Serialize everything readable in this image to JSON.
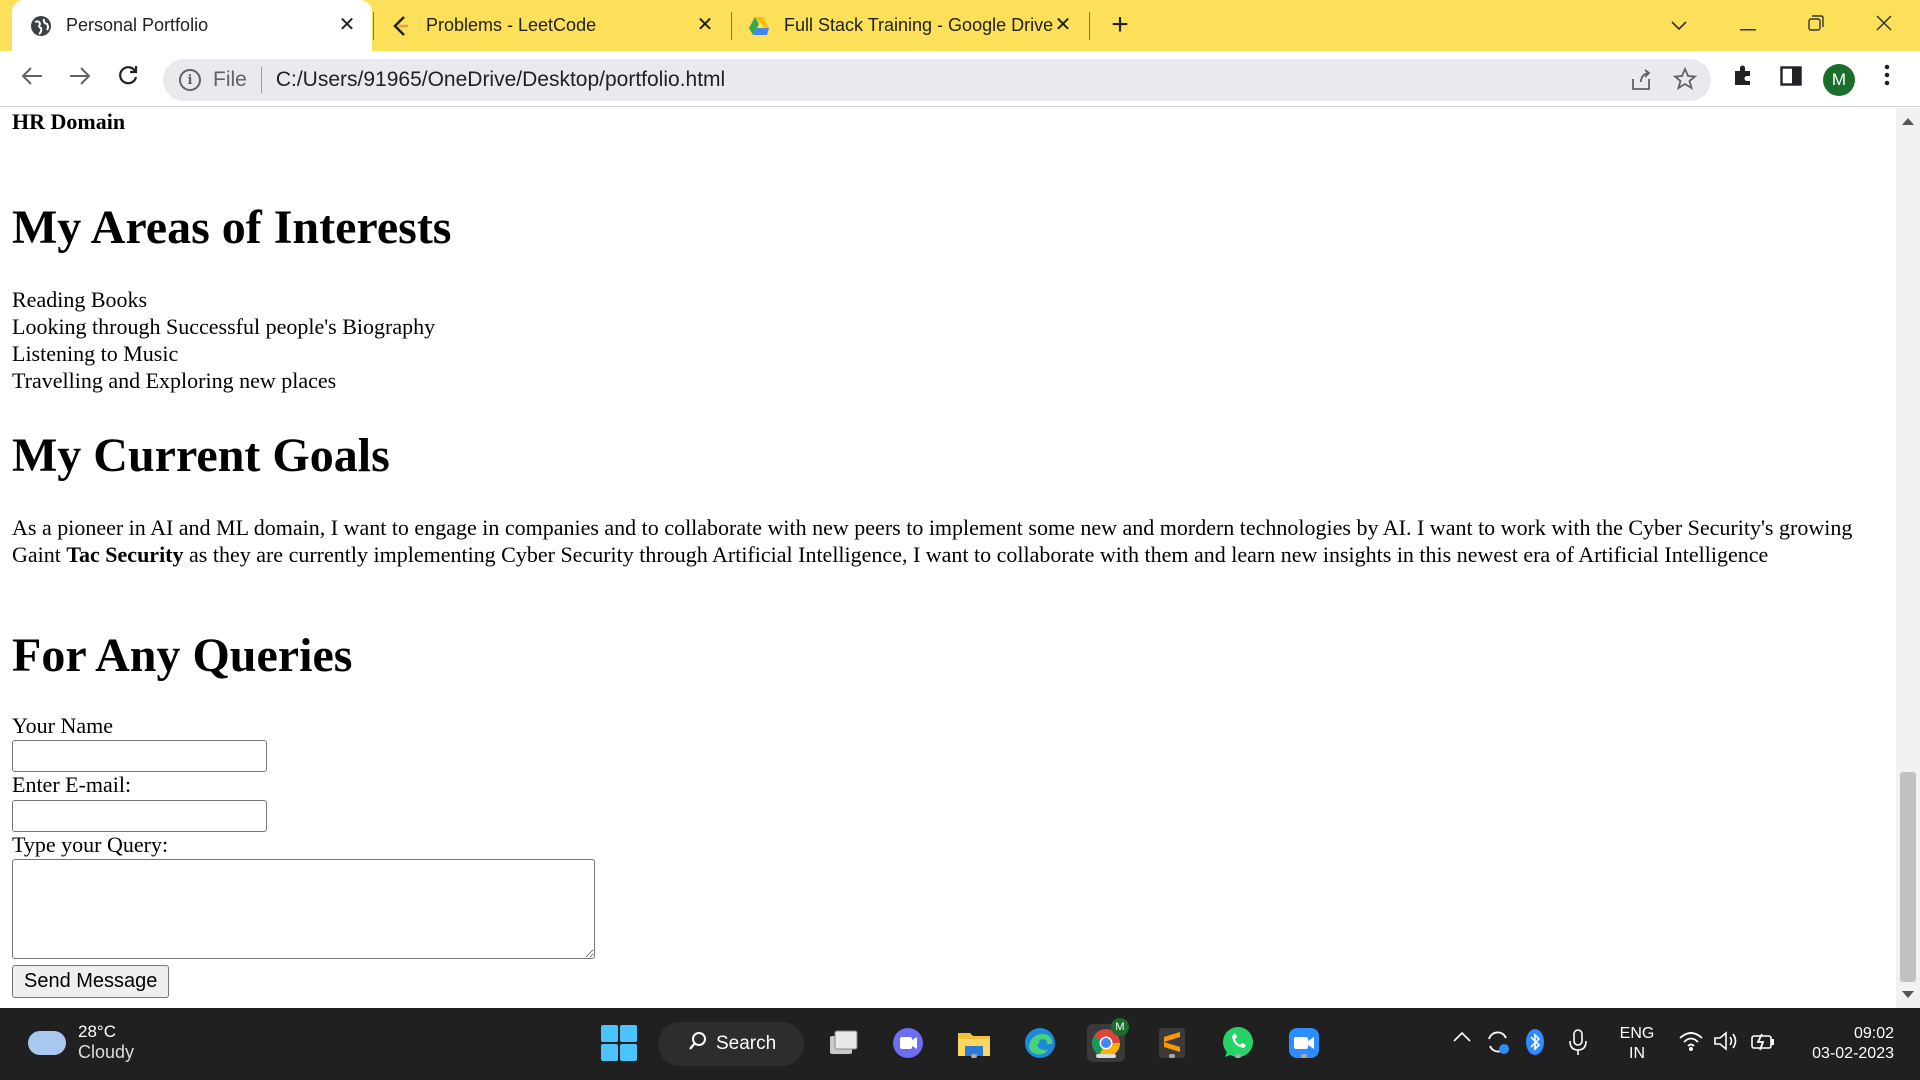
{
  "browser": {
    "tabs": [
      {
        "title": "Personal Portfolio"
      },
      {
        "title": "Problems - LeetCode"
      },
      {
        "title": "Full Stack Training - Google Drive"
      }
    ],
    "address": {
      "scheme": "File",
      "url": "C:/Users/91965/OneDrive/Desktop/portfolio.html"
    },
    "profile_initial": "M"
  },
  "page": {
    "previous_item": "HR Domain",
    "interests": {
      "title": "My Areas of Interests",
      "items": [
        "Reading Books",
        "Looking through Successful people's Biography",
        "Listening to Music",
        "Travelling and Exploring new places"
      ]
    },
    "goals": {
      "title": "My Current Goals",
      "text_before": "As a pioneer in AI and ML domain, I want to engage in companies and to collaborate with new peers to implement some new and mordern technologies by AI. I want to work with the Cyber Security's growing Gaint ",
      "highlight": "Tac Security",
      "text_after": " as they are currently implementing Cyber Security through Artificial Intelligence, I want to collaborate with them and learn new insights in this newest era of Artificial Intelligence"
    },
    "queries": {
      "title": "For Any Queries",
      "name_label": "Your Name",
      "name_value": "",
      "email_label": "Enter E-mail:",
      "email_value": "",
      "query_label": "Type your Query:",
      "query_value": "",
      "submit_label": "Send Message"
    }
  },
  "taskbar": {
    "weather_temp": "28°C",
    "weather_desc": "Cloudy",
    "search_label": "Search",
    "lang_1": "ENG",
    "lang_2": "IN",
    "time": "09:02",
    "date": "03-02-2023",
    "chrome_badge": "M"
  }
}
